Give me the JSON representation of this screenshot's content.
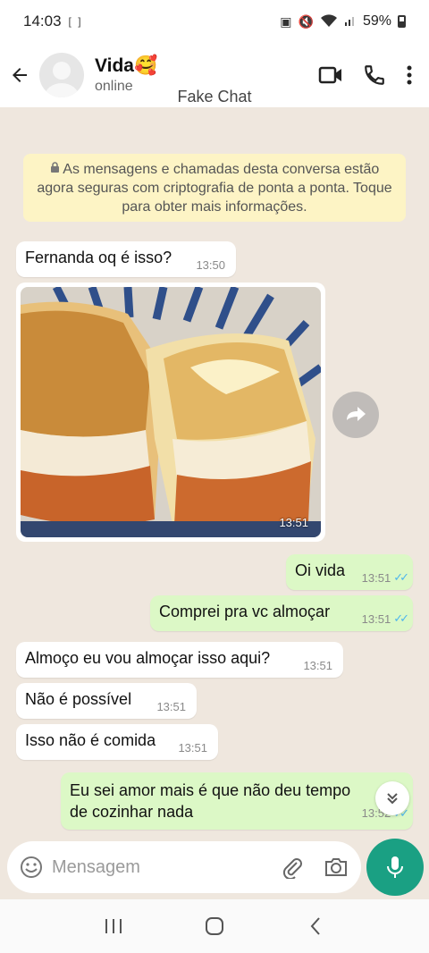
{
  "status_bar": {
    "time": "14:03",
    "battery": "59%"
  },
  "header": {
    "contact_name": "Vida🥰",
    "contact_status": "online",
    "watermark": "Fake Chat"
  },
  "encryption_notice": "As mensagens e chamadas desta conversa estão agora seguras com criptografia de ponta a ponta. Toque para obter mais informações.",
  "messages": [
    {
      "direction": "in",
      "text": "Fernanda oq é isso?",
      "time": "13:50"
    },
    {
      "direction": "in",
      "type": "image",
      "image_desc": "food-photo",
      "time": "13:51"
    },
    {
      "direction": "out",
      "text": "Oi vida",
      "time": "13:51",
      "read": true
    },
    {
      "direction": "out",
      "text": "Comprei pra vc almoçar",
      "time": "13:51",
      "read": true
    },
    {
      "direction": "in",
      "text": "Almoço eu vou almoçar isso aqui?",
      "time": "13:51"
    },
    {
      "direction": "in",
      "text": "Não é possível",
      "time": "13:51"
    },
    {
      "direction": "in",
      "text": "Isso não é comida",
      "time": "13:51"
    },
    {
      "direction": "out",
      "text": "Eu sei amor mais é que não deu tempo de cozinhar nada",
      "time": "13:52",
      "read": true
    }
  ],
  "input": {
    "placeholder": "Mensagem"
  },
  "icons": {
    "back": "arrow-left-icon",
    "video": "video-camera-icon",
    "call": "phone-icon",
    "menu": "more-vertical-icon",
    "emoji": "emoji-icon",
    "attach": "paperclip-icon",
    "camera": "camera-icon",
    "mic": "microphone-icon"
  },
  "colors": {
    "chat_bg": "#efe7de",
    "outgoing_bubble": "#dcf8c6",
    "incoming_bubble": "#ffffff",
    "notice_bg": "#fdf4c5",
    "accent": "#1aa083",
    "read_ticks": "#4fb6ec"
  }
}
